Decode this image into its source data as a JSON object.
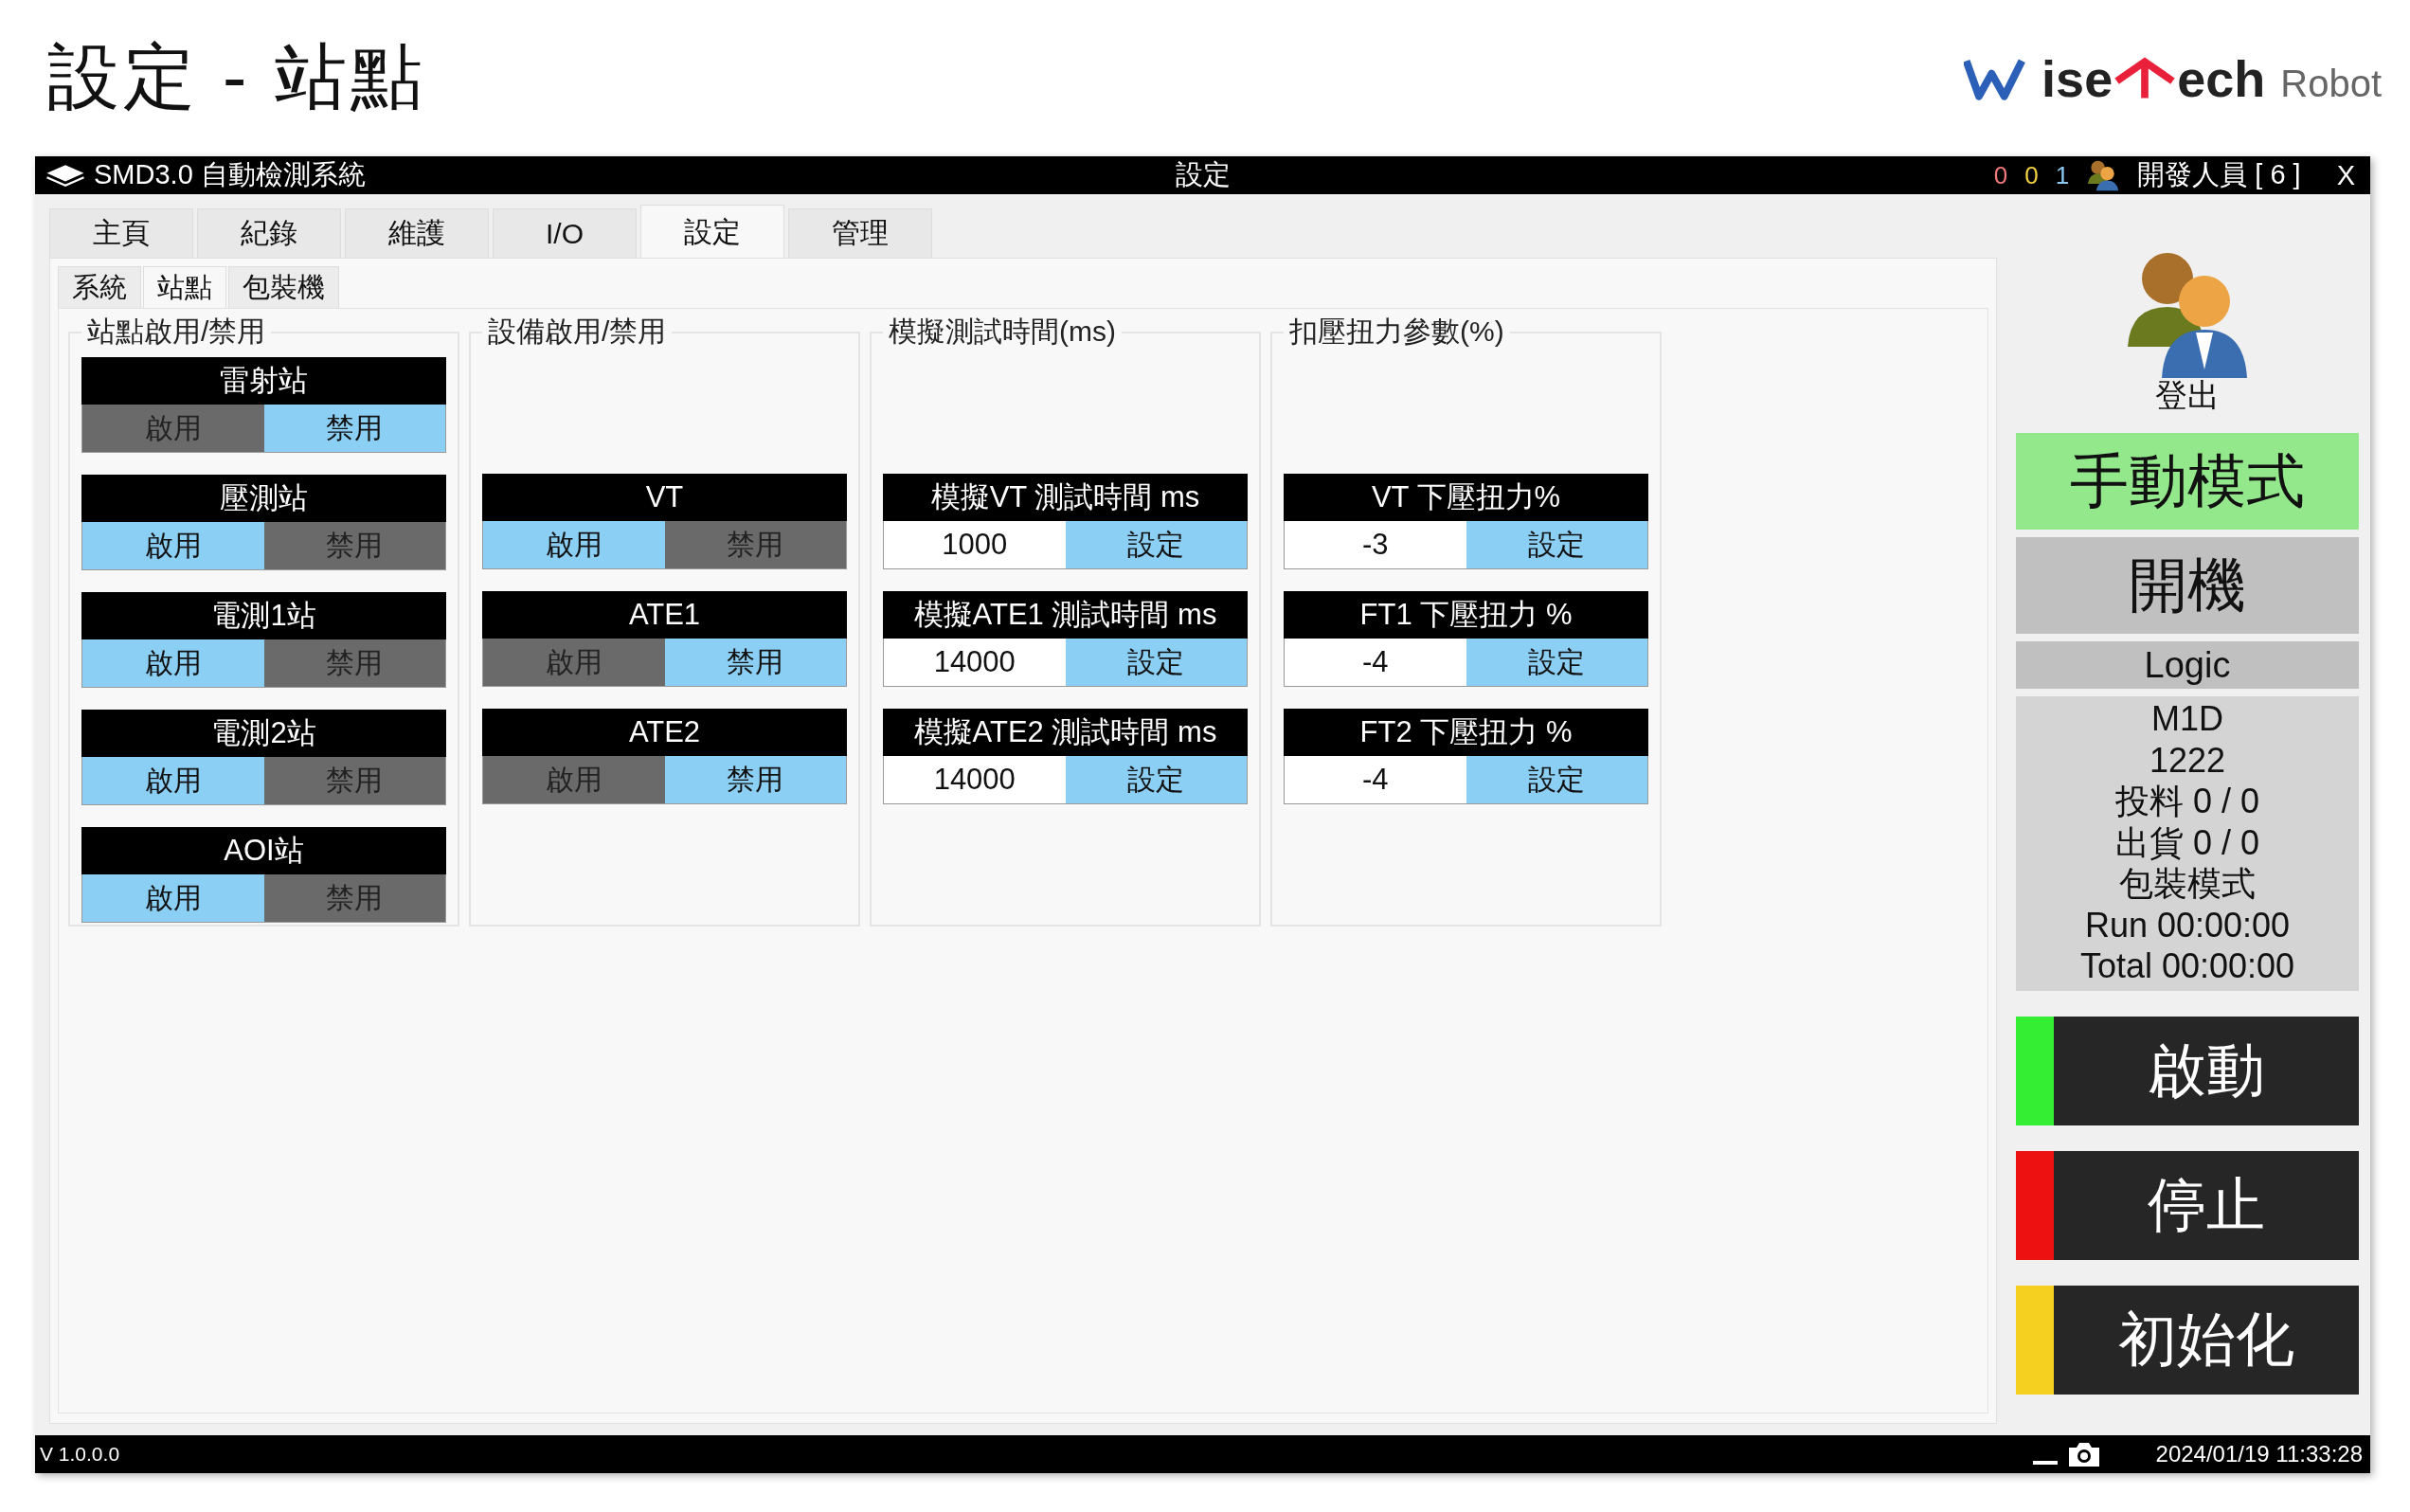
{
  "page_title": "設定 - 站點",
  "logo": {
    "word_1": "ise",
    "word_2": "ech",
    "word_3": "Robot"
  },
  "window": {
    "title": "SMD3.0 自動檢測系統",
    "center_title": "設定",
    "counters": [
      {
        "text": "0",
        "color": "#f07a7a"
      },
      {
        "text": "0",
        "color": "#f0d040"
      },
      {
        "text": "1",
        "color": "#8cc8f0"
      }
    ],
    "user": "開發人員 [ 6 ]",
    "close": "X"
  },
  "tabs": [
    {
      "label": "主頁",
      "selected": false
    },
    {
      "label": "紀錄",
      "selected": false
    },
    {
      "label": "維護",
      "selected": false
    },
    {
      "label": "I/O",
      "selected": false
    },
    {
      "label": "設定",
      "selected": true
    },
    {
      "label": "管理",
      "selected": false
    }
  ],
  "sub_tabs": [
    {
      "label": "系統",
      "selected": false
    },
    {
      "label": "站點",
      "selected": true
    },
    {
      "label": "包裝機",
      "selected": false
    }
  ],
  "groups": [
    {
      "title": "站點啟用/禁用",
      "kind": "toggle",
      "cards": [
        {
          "title": "雷射站",
          "buttons": [
            {
              "label": "啟用",
              "selected": false
            },
            {
              "label": "禁用",
              "selected": true
            }
          ]
        },
        {
          "title": "壓測站",
          "buttons": [
            {
              "label": "啟用",
              "selected": true
            },
            {
              "label": "禁用",
              "selected": false
            }
          ]
        },
        {
          "title": "電測1站",
          "buttons": [
            {
              "label": "啟用",
              "selected": true
            },
            {
              "label": "禁用",
              "selected": false
            }
          ]
        },
        {
          "title": "電測2站",
          "buttons": [
            {
              "label": "啟用",
              "selected": true
            },
            {
              "label": "禁用",
              "selected": false
            }
          ]
        },
        {
          "title": "AOI站",
          "buttons": [
            {
              "label": "啟用",
              "selected": true
            },
            {
              "label": "禁用",
              "selected": false
            }
          ]
        }
      ]
    },
    {
      "title": "設備啟用/禁用",
      "kind": "toggle",
      "cards": [
        {
          "title": "VT",
          "buttons": [
            {
              "label": "啟用",
              "selected": true
            },
            {
              "label": "禁用",
              "selected": false
            }
          ]
        },
        {
          "title": "ATE1",
          "buttons": [
            {
              "label": "啟用",
              "selected": false
            },
            {
              "label": "禁用",
              "selected": true
            }
          ]
        },
        {
          "title": "ATE2",
          "buttons": [
            {
              "label": "啟用",
              "selected": false
            },
            {
              "label": "禁用",
              "selected": true
            }
          ]
        }
      ]
    },
    {
      "title": "模擬測試時間(ms)",
      "kind": "input",
      "cards": [
        {
          "title": "模擬VT 測試時間 ms",
          "value": "1000",
          "button": "設定"
        },
        {
          "title": "模擬ATE1 測試時間 ms",
          "value": "14000",
          "button": "設定"
        },
        {
          "title": "模擬ATE2 測試時間 ms",
          "value": "14000",
          "button": "設定"
        }
      ]
    },
    {
      "title": "扣壓扭力參數(%)",
      "kind": "input",
      "cards": [
        {
          "title": "VT 下壓扭力%",
          "value": "-3",
          "button": "設定"
        },
        {
          "title": "FT1 下壓扭力 %",
          "value": "-4",
          "button": "設定"
        },
        {
          "title": "FT2 下壓扭力 %",
          "value": "-4",
          "button": "設定"
        }
      ]
    }
  ],
  "side": {
    "logout": "登出",
    "mode": "手動模式",
    "power": "開機",
    "logic": "Logic",
    "info": [
      "M1D",
      "1222",
      "投料 0 / 0",
      "出貨 0 / 0",
      "包裝模式",
      "Run 00:00:00",
      "Total 00:00:00"
    ],
    "actions": [
      {
        "label": "啟動",
        "color": "#33ee33"
      },
      {
        "label": "停止",
        "color": "#ee1111"
      },
      {
        "label": "初始化",
        "color": "#f5d020"
      }
    ]
  },
  "status_bar": {
    "version": "V 1.0.0.0",
    "datetime": "2024/01/19 11:33:28"
  }
}
